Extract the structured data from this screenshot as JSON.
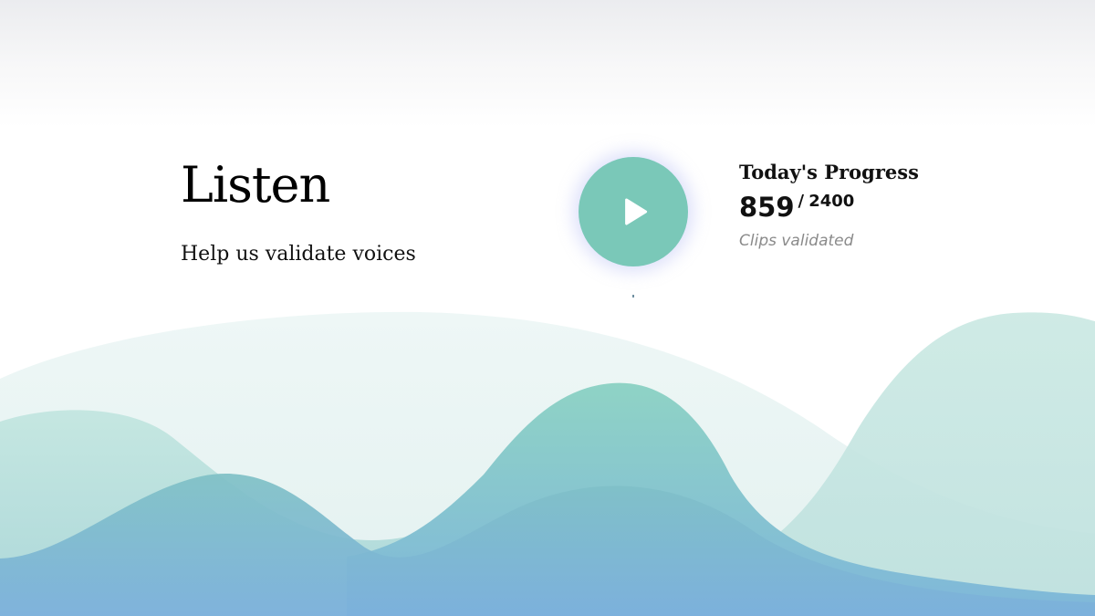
{
  "hero": {
    "title": "Listen",
    "subtitle": "Help us validate voices"
  },
  "player": {
    "play_icon": "play-icon",
    "accent": "#7ac8b8"
  },
  "progress": {
    "title": "Today's Progress",
    "current": "859",
    "separator": "/",
    "goal": "2400",
    "caption": "Clips validated"
  },
  "theme": {
    "wave_light": "#c6e7e1",
    "wave_teal": "#8bd1c3",
    "wave_blue": "#7fb4dc"
  }
}
